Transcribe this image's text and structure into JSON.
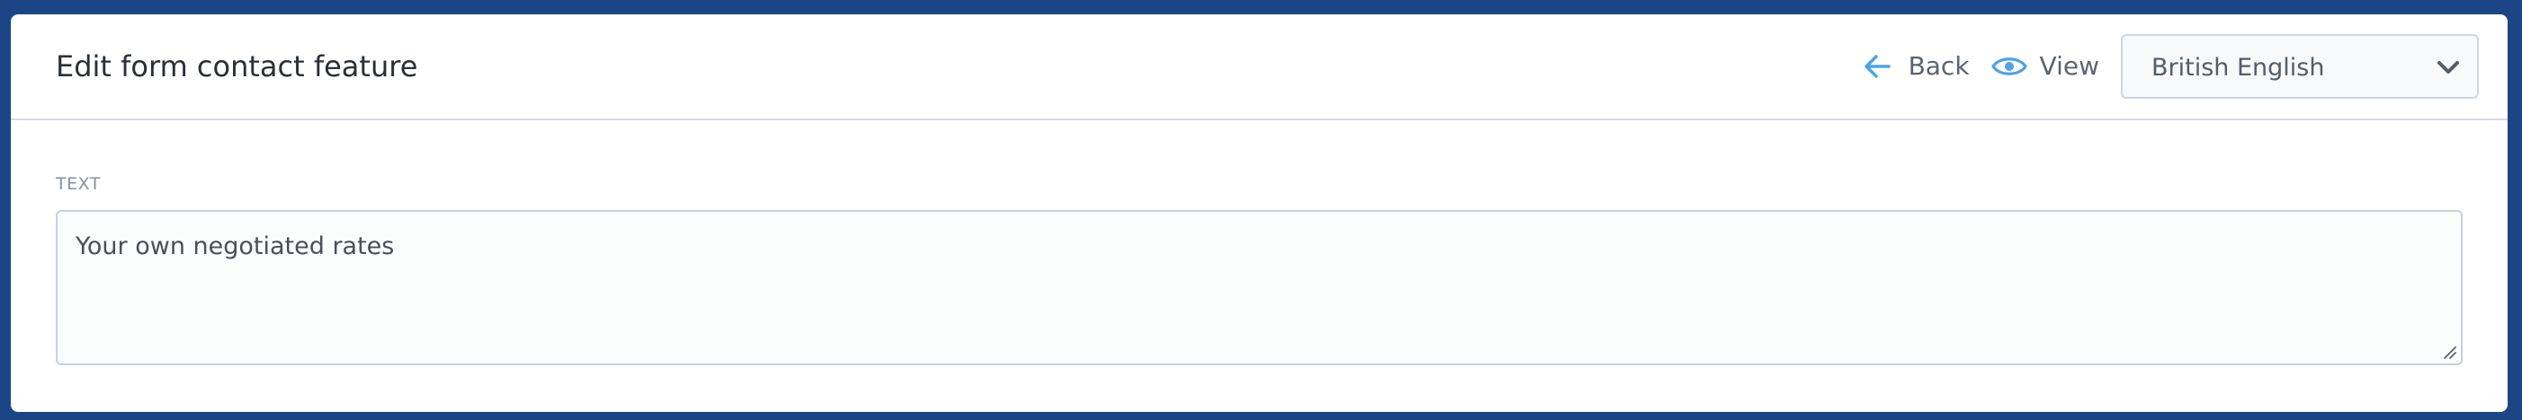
{
  "header": {
    "title": "Edit form contact feature",
    "back_label": "Back",
    "view_label": "View",
    "language_selected": "British English"
  },
  "form": {
    "text_label": "TEXT",
    "text_value": "Your own negotiated rates"
  },
  "colors": {
    "frame_bg": "#1c4586",
    "accent_icon": "#4da3e6",
    "panel_bg": "#ffffff"
  },
  "icons": {
    "back": "arrow-left-icon",
    "view": "eye-icon",
    "select": "chevron-down-icon",
    "resize": "resize-handle-icon"
  }
}
